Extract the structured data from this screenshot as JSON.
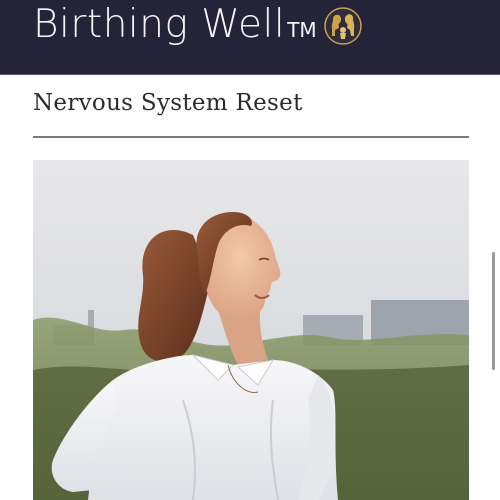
{
  "header": {
    "brand_name": "Birthing Well",
    "brand_tm": "TM",
    "background": "#242338",
    "logo_icon": "mother-child-gold-logo-icon"
  },
  "main": {
    "page_title": "Nervous System Reset",
    "hero_image": "woman-smiling-outdoors-photo"
  },
  "colors": {
    "header_bg": "#242338",
    "logo_gold": "#c9a24a",
    "text_dark": "#2b2b2b",
    "divider": "#7a7a7a"
  }
}
